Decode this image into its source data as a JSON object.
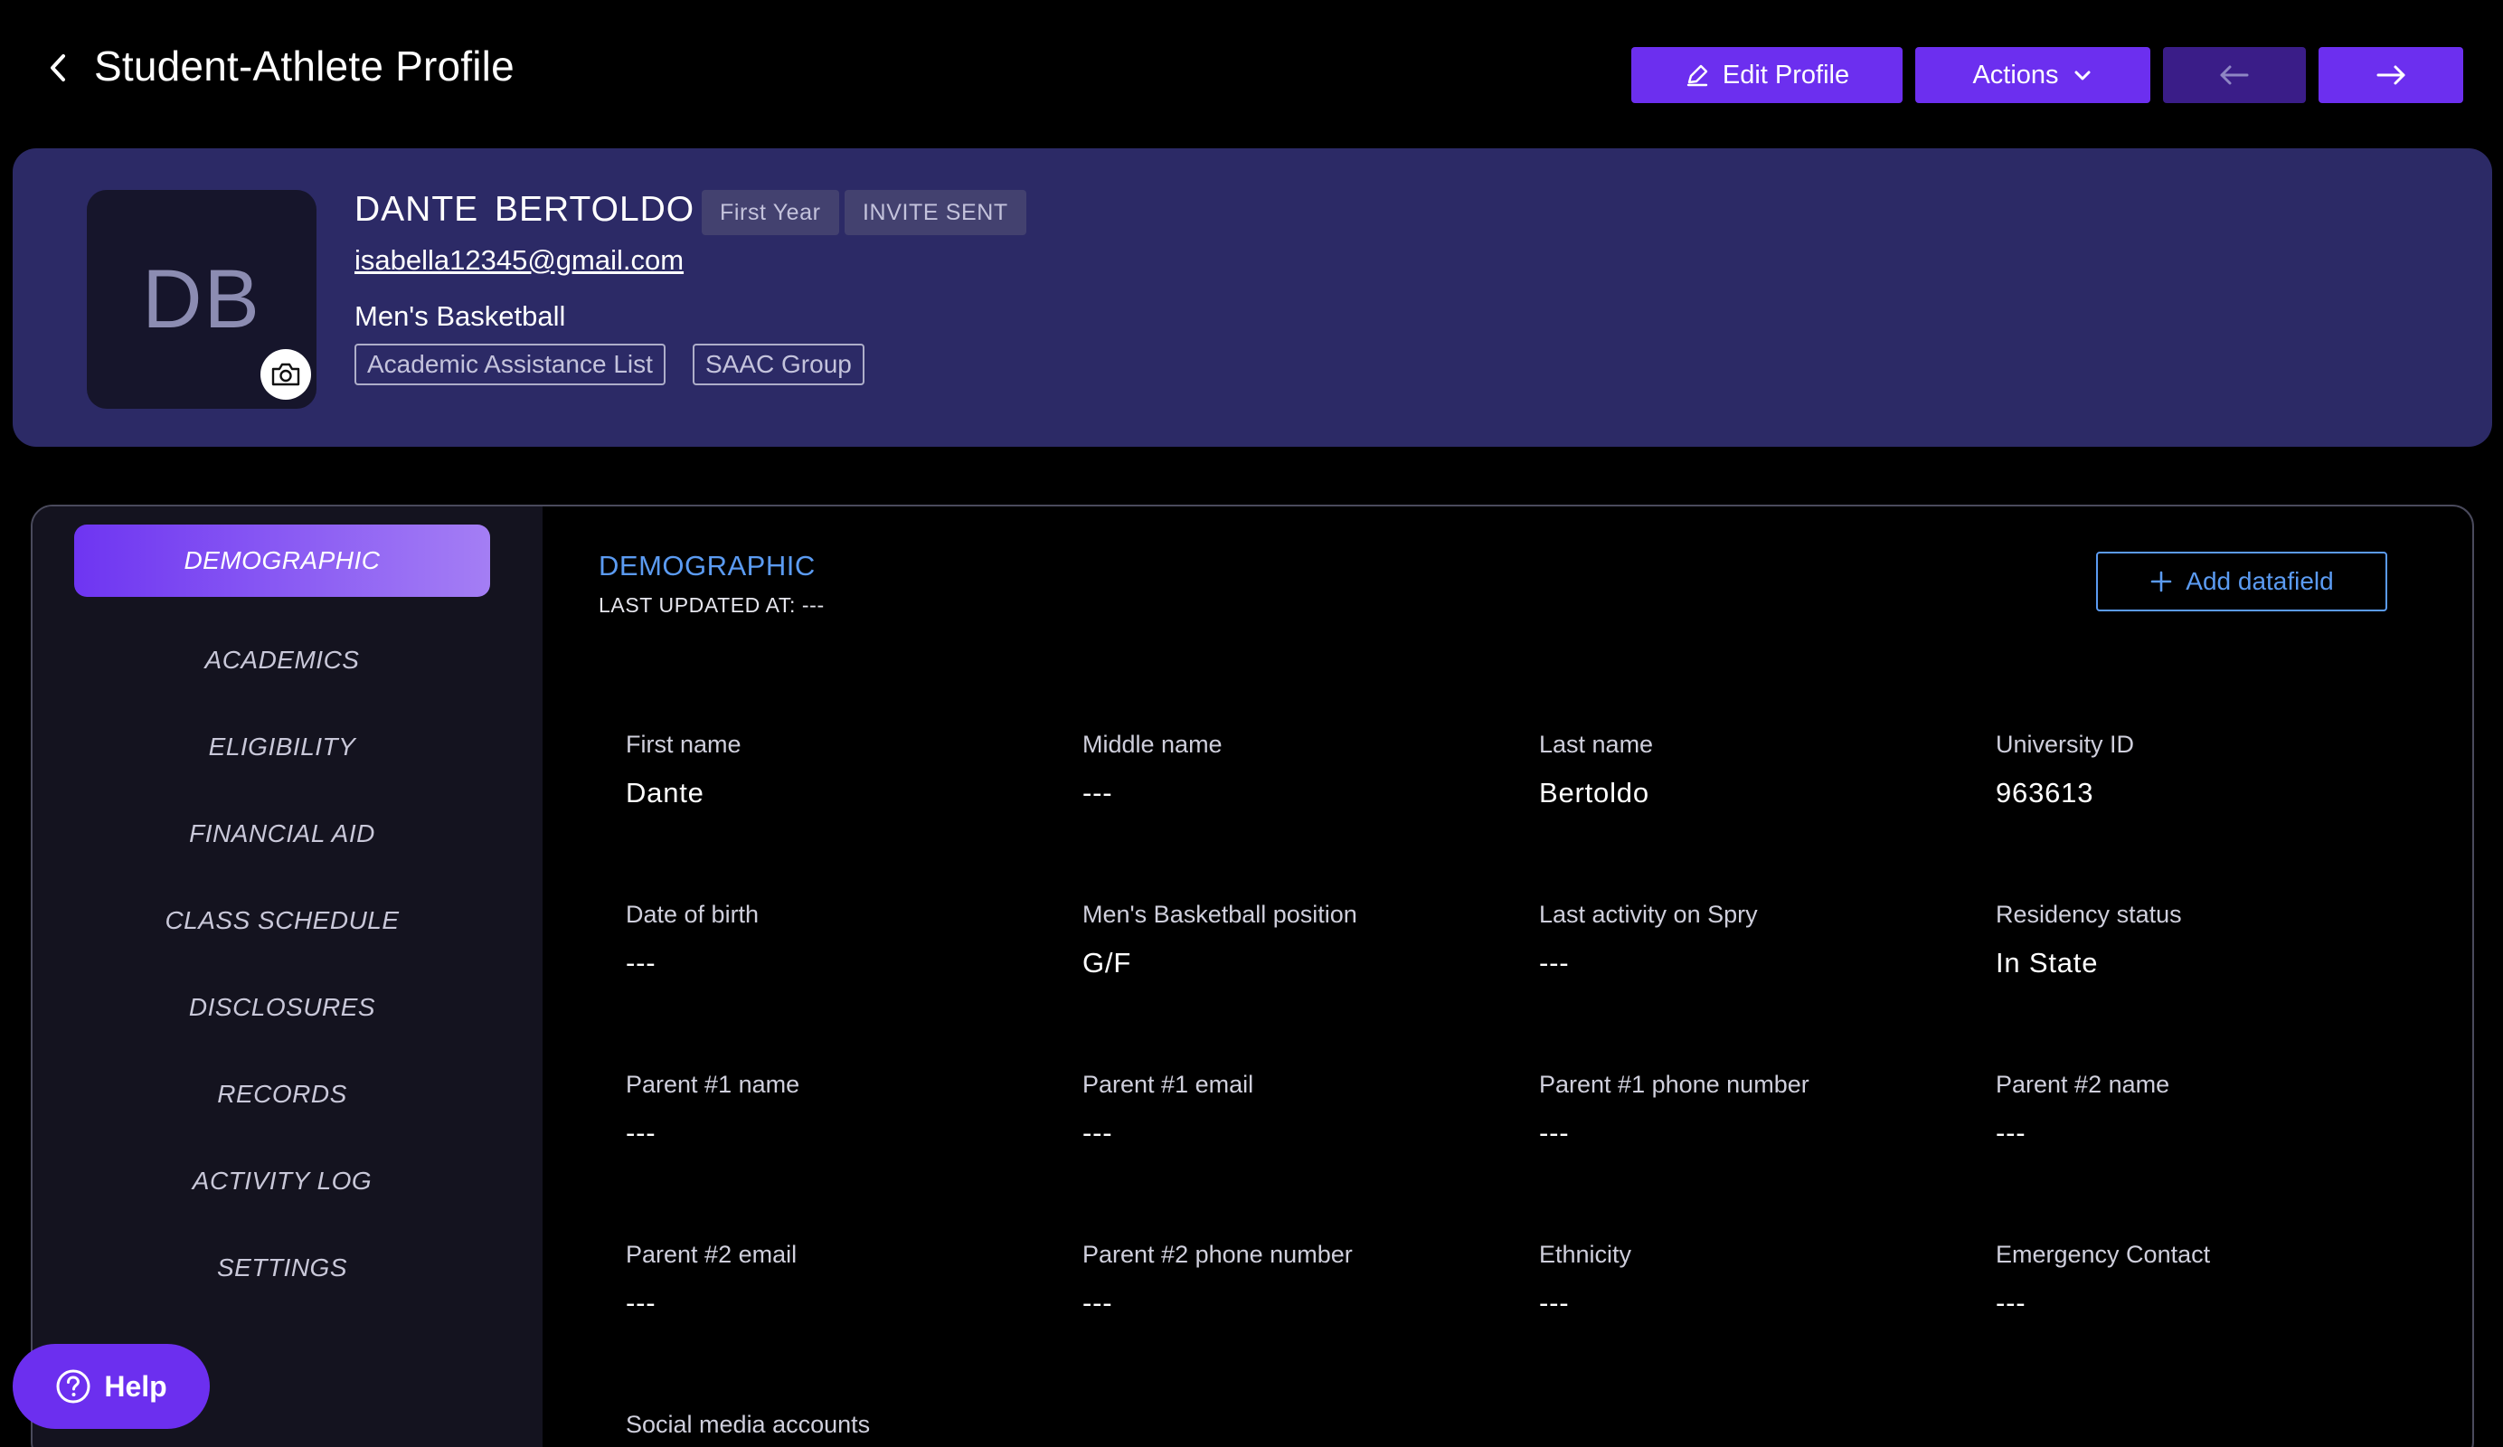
{
  "header": {
    "title": "Student-Athlete Profile",
    "edit_label": "Edit Profile",
    "actions_label": "Actions"
  },
  "profile": {
    "initials": "DB",
    "name": "DANTE  BERTOLDO",
    "year_badge": "First Year",
    "status_badge": "INVITE SENT",
    "email": "isabella12345@gmail.com",
    "sport": "Men's Basketball",
    "tags": [
      "Academic Assistance List",
      "SAAC Group"
    ]
  },
  "sidebar": {
    "items": [
      {
        "label": "DEMOGRAPHIC",
        "active": true
      },
      {
        "label": "ACADEMICS"
      },
      {
        "label": "ELIGIBILITY"
      },
      {
        "label": "FINANCIAL AID"
      },
      {
        "label": "CLASS SCHEDULE"
      },
      {
        "label": "DISCLOSURES"
      },
      {
        "label": "RECORDS"
      },
      {
        "label": "ACTIVITY LOG"
      },
      {
        "label": "SETTINGS"
      }
    ]
  },
  "section": {
    "title": "DEMOGRAPHIC",
    "last_updated": "LAST UPDATED AT: ---",
    "add_label": "Add datafield"
  },
  "fields": [
    {
      "label": "First name",
      "value": "Dante"
    },
    {
      "label": "Middle name",
      "value": "---"
    },
    {
      "label": "Last name",
      "value": "Bertoldo"
    },
    {
      "label": "University ID",
      "value": "963613"
    },
    {
      "label": "Date of birth",
      "value": "---"
    },
    {
      "label": "Men's Basketball position",
      "value": "G/F"
    },
    {
      "label": "Last activity on Spry",
      "value": "---"
    },
    {
      "label": "Residency status",
      "value": "In State"
    },
    {
      "label": "Parent #1 name",
      "value": "---"
    },
    {
      "label": "Parent #1 email",
      "value": "---"
    },
    {
      "label": "Parent #1 phone number",
      "value": "---"
    },
    {
      "label": "Parent #2 name",
      "value": "---"
    },
    {
      "label": "Parent #2 email",
      "value": "---"
    },
    {
      "label": "Parent #2 phone number",
      "value": "---"
    },
    {
      "label": "Ethnicity",
      "value": "---"
    },
    {
      "label": "Emergency Contact",
      "value": "---"
    },
    {
      "label": "Social media accounts",
      "value": ""
    }
  ],
  "help": {
    "label": "Help"
  },
  "colors": {
    "accent": "#6c2fef",
    "card": "#2c2a66",
    "link_blue": "#5b9bf2"
  }
}
